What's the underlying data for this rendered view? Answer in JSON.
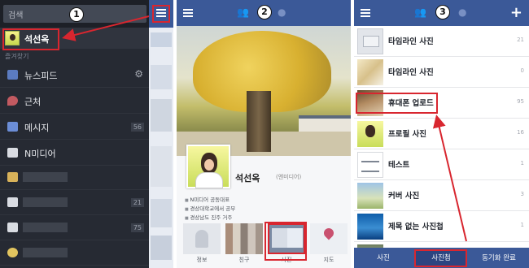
{
  "panel1": {
    "step": "1",
    "search_placeholder": "검색",
    "profile_name": "석선옥",
    "favorites_label": "즐겨찾기",
    "items": [
      {
        "label": "뉴스피드",
        "icon": "newsfeed-icon",
        "color": "#5b7bc0"
      },
      {
        "label": "근처",
        "icon": "nearby-pin-icon",
        "color": "#c25a61"
      },
      {
        "label": "메시지",
        "icon": "messages-icon",
        "color": "#6b8dd6"
      },
      {
        "label": "N미디어",
        "icon": "nmedia-icon",
        "color": "#d9dce2"
      }
    ],
    "counts": {
      "messages": "56",
      "row6": "21",
      "row7": "75"
    }
  },
  "panel2": {
    "step": "2",
    "name": "석선옥",
    "nickname": "(엔미디어)",
    "info_lines": [
      "N미디어 공동대표",
      "경상대학교에서 공부",
      "경상남도 진주 거주"
    ],
    "tiles": [
      "정보",
      "친구",
      "사진",
      "지도"
    ]
  },
  "panel3": {
    "step": "3",
    "albums": [
      {
        "title": "타임라인 사진",
        "count": "21"
      },
      {
        "title": "타임라인 사진",
        "count": "0"
      },
      {
        "title": "휴대폰 업로드",
        "count": "95"
      },
      {
        "title": "프로필 사진",
        "count": "16"
      },
      {
        "title": "테스트",
        "count": "1"
      },
      {
        "title": "커버 사진",
        "count": "3"
      },
      {
        "title": "제목 없는 사진첩",
        "count": "1"
      }
    ],
    "bottom_tabs": [
      "사진",
      "사진첩",
      "동기화 완료"
    ]
  },
  "colors": {
    "facebook_blue": "#3b5998",
    "highlight_red": "#d8262f",
    "menu_dark": "#262a33"
  }
}
